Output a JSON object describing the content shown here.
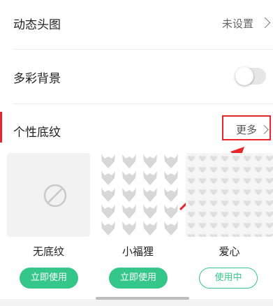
{
  "settings": {
    "dynamic_header": {
      "label": "动态头图",
      "value": "未设置"
    },
    "colorful_bg": {
      "label": "多彩背景",
      "enabled": false
    },
    "texture": {
      "label": "个性底纹",
      "more": "更多"
    }
  },
  "textures": [
    {
      "label": "无底纹",
      "button": "立即使用",
      "state": "available"
    },
    {
      "label": "小福狸",
      "button": "立即使用",
      "state": "available"
    },
    {
      "label": "爱心",
      "button": "使用中",
      "state": "in-use"
    }
  ],
  "colors": {
    "accent": "#35c78a",
    "highlight": "#e8272d"
  }
}
